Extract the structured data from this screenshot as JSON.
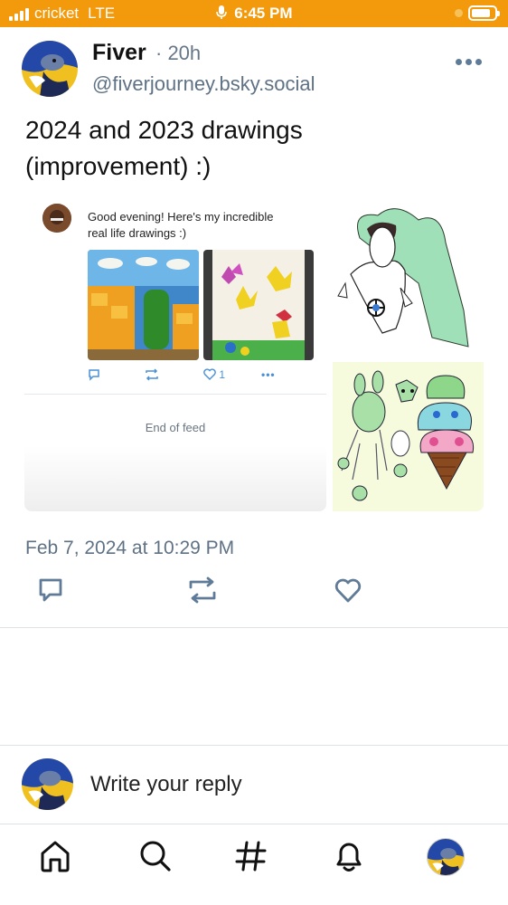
{
  "status_bar": {
    "carrier": "cricket",
    "network": "LTE",
    "time": "6:45 PM",
    "icons": [
      "signal-icon",
      "microphone-icon",
      "battery-icon"
    ]
  },
  "post": {
    "author_name": "Fiver",
    "time_ago": "· 20h",
    "handle": "@fiverjourney.bsky.social",
    "text_line1": "2024 and 2023 drawings",
    "text_line2": "(improvement) :)",
    "timestamp": "Feb 7, 2024 at 10:29 PM",
    "more_icon": "ellipsis-icon"
  },
  "embedded_screenshot": {
    "text_line1": "Good evening! Here's my incredible",
    "text_line2": "real life drawings :)",
    "like_count": "1",
    "end_text": "End of feed"
  },
  "post_actions": [
    "reply-icon",
    "repost-icon",
    "like-icon"
  ],
  "reply": {
    "placeholder": "Write your reply"
  },
  "tab_bar": {
    "tabs": [
      "home-icon",
      "search-icon",
      "hashtag-icon",
      "notifications-icon",
      "profile-avatar"
    ]
  },
  "colors": {
    "status_bar": "#f29a0c",
    "icon_blue": "#5f7b97",
    "secondary_text": "#5f7285",
    "action_blue": "#4a90d9"
  }
}
